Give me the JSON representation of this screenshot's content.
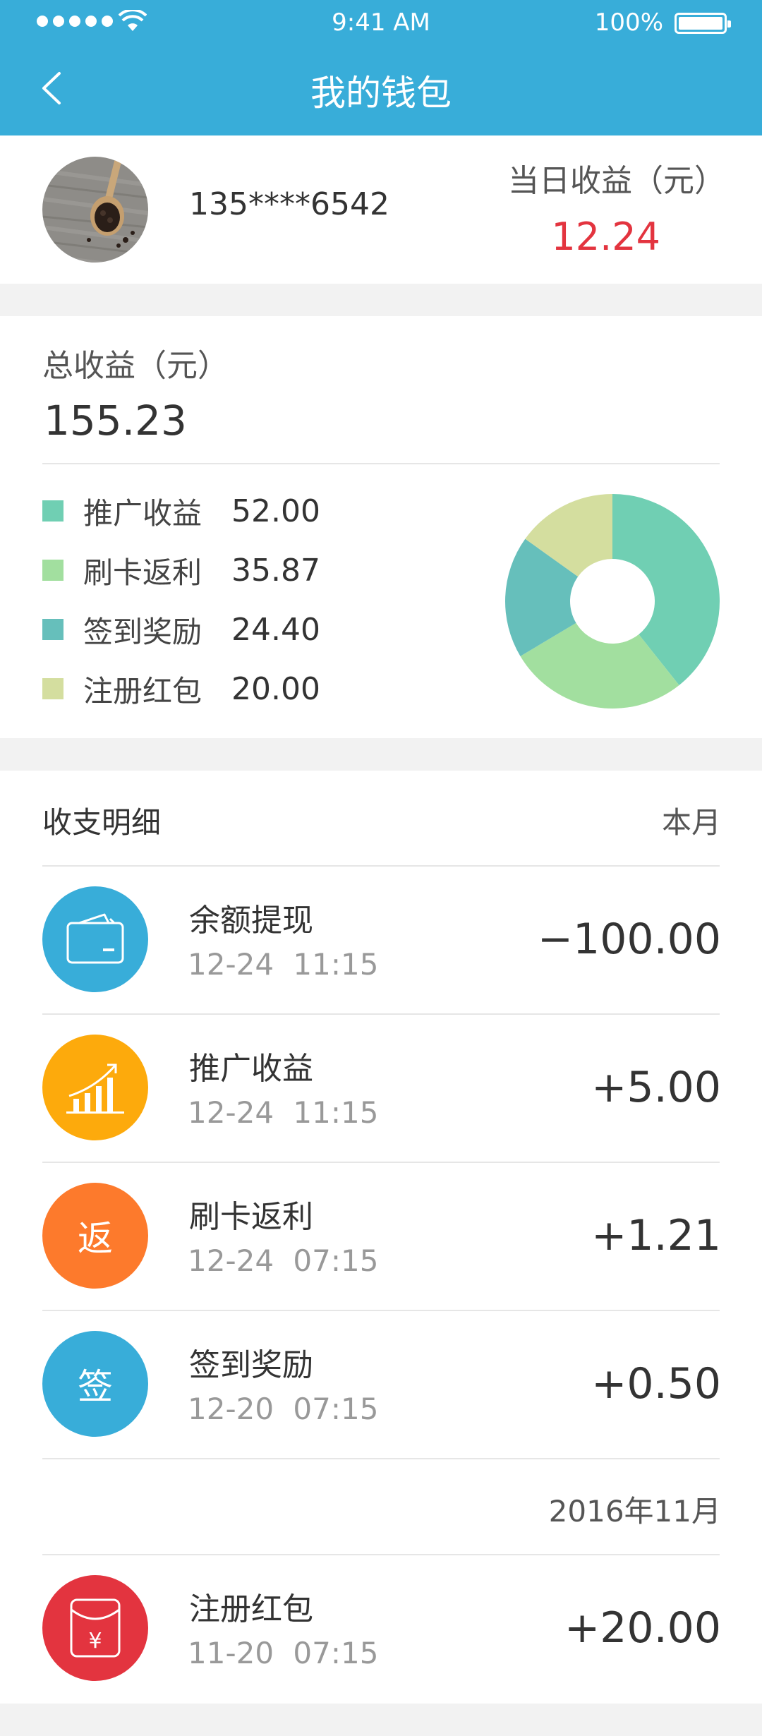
{
  "status": {
    "time": "9:41 AM",
    "battery": "100%"
  },
  "nav": {
    "title": "我的钱包"
  },
  "profile": {
    "phone": "135****6542",
    "today_label": "当日收益（元）",
    "today_value": "12.24"
  },
  "total": {
    "label": "总收益（元）",
    "value": "155.23",
    "breakdown": [
      {
        "name": "推广收益",
        "value": "52.00",
        "amount": 52.0,
        "color": "#70cfb3"
      },
      {
        "name": "刷卡返利",
        "value": "35.87",
        "amount": 35.87,
        "color": "#a2df9f"
      },
      {
        "name": "签到奖励",
        "value": "24.40",
        "amount": 24.4,
        "color": "#66bfbb"
      },
      {
        "name": "注册红包",
        "value": "20.00",
        "amount": 20.0,
        "color": "#d4de9f"
      }
    ]
  },
  "details": {
    "title": "收支明细",
    "month": "本月",
    "transactions": [
      {
        "name": "余额提现",
        "date": "12-24",
        "time": "11:15",
        "amount": "−100.00",
        "icon": "wallet-icon",
        "color": "#38add9"
      },
      {
        "name": "推广收益",
        "date": "12-24",
        "time": "11:15",
        "amount": "+5.00",
        "icon": "growth-chart-icon",
        "color": "#fdaa0c"
      },
      {
        "name": "刷卡返利",
        "date": "12-24",
        "time": "07:15",
        "amount": "+1.21",
        "icon": "rebate-icon",
        "icon_text": "返",
        "color": "#fd7a2c"
      },
      {
        "name": "签到奖励",
        "date": "12-20",
        "time": "07:15",
        "amount": "+0.50",
        "icon": "checkin-icon",
        "icon_text": "签",
        "color": "#38add9"
      }
    ],
    "section_label": "2016年11月",
    "earlier": [
      {
        "name": "注册红包",
        "date": "11-20",
        "time": "07:15",
        "amount": "+20.00",
        "icon": "red-envelope-icon",
        "color": "#e3343f"
      }
    ]
  }
}
